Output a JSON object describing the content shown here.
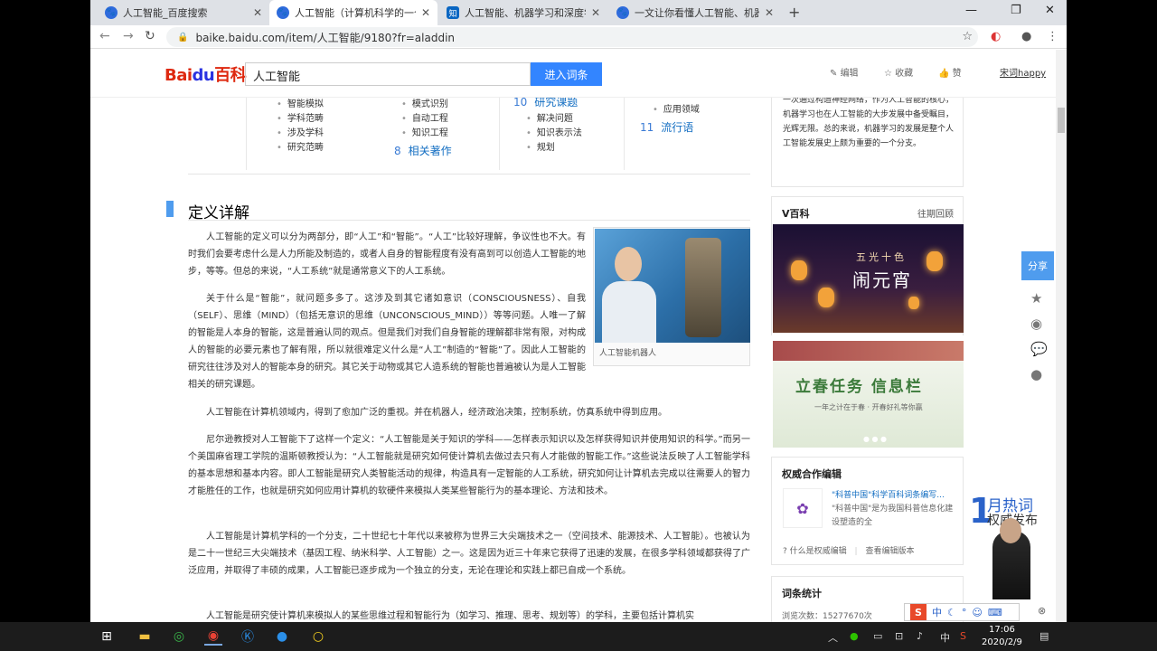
{
  "tabs": [
    {
      "title": "人工智能_百度搜索"
    },
    {
      "title": "人工智能（计算机科学的一个分支）"
    },
    {
      "title": "人工智能、机器学习和深度学习的"
    },
    {
      "title": "一文让你看懂人工智能、机器学"
    }
  ],
  "tab_close": "✕",
  "new_tab": "+",
  "window": {
    "min": "—",
    "max": "❐",
    "close": "✕"
  },
  "address": {
    "url": "baike.baidu.com/item/人工智能/9180?fr=aladdin"
  },
  "header": {
    "logo_a": "Bai",
    "logo_b": "du",
    "logo_c": "百科",
    "search_value": "人工智能",
    "search_button": "进入词条",
    "edit": "编辑",
    "collect": "收藏",
    "like": "赞",
    "user": "宋词happy"
  },
  "toc": {
    "col1": [
      "智能模拟",
      "学科范畴",
      "涉及学科",
      "研究范畴"
    ],
    "col2": [
      "模式识别",
      "自动工程",
      "知识工程"
    ],
    "col3": [
      "解决问题",
      "知识表示法",
      "规划"
    ],
    "col4": [
      "应用领域"
    ],
    "sec10_num": "10",
    "sec10": "研究课题",
    "sec8_num": "8",
    "sec8": "相关著作",
    "sec11_num": "11",
    "sec11": "流行语"
  },
  "section_title": "定义详解",
  "figure_caption": "人工智能机器人",
  "paragraphs": {
    "p1": "人工智能的定义可以分为两部分，即“人工”和“智能”。“人工”比较好理解，争议性也不大。有时我们会要考虑什么是人力所能及制造的，或者人自身的智能程度有没有高到可以创造人工智能的地步，等等。但总的来说，“人工系统”就是通常意义下的人工系统。",
    "p2": "关于什么是“智能”，就问题多多了。这涉及到其它诸如意识（CONSCIOUSNESS）、自我（SELF）、思维（MIND）（包括无意识的思维（UNCONSCIOUS_MIND））等等问题。人唯一了解的智能是人本身的智能，这是普遍认同的观点。但是我们对我们自身智能的理解都非常有限，对构成人的智能的必要元素也了解有限，所以就很难定义什么是“人工”制造的“智能”了。因此人工智能的研究往往涉及对人的智能本身的研究。其它关于动物或其它人造系统的智能也普遍被认为是人工智能相关的研究课题。",
    "p3": "人工智能在计算机领域内，得到了愈加广泛的重视。并在机器人，经济政治决策，控制系统，仿真系统中得到应用。",
    "p4": "尼尔逊教授对人工智能下了这样一个定义：“人工智能是关于知识的学科——怎样表示知识以及怎样获得知识并使用知识的科学。”而另一个美国麻省理工学院的温斯顿教授认为：“人工智能就是研究如何使计算机去做过去只有人才能做的智能工作。”这些说法反映了人工智能学科的基本思想和基本内容。即人工智能是研究人类智能活动的规律，构造具有一定智能的人工系统，研究如何让计算机去完成以往需要人的智力才能胜任的工作，也就是研究如何应用计算机的软硬件来模拟人类某些智能行为的基本理论、方法和技术。",
    "p5": "人工智能是计算机学科的一个分支，二十世纪七十年代以来被称为世界三大尖端技术之一（空间技术、能源技术、人工智能）。也被认为是二十一世纪三大尖端技术（基因工程、纳米科学、人工智能）之一。这是因为近三十年来它获得了迅速的发展，在很多学科领域都获得了广泛应用，并取得了丰硕的成果，人工智能已逐步成为一个独立的分支，无论在理论和实践上都已自成一个系统。",
    "p6": "人工智能是研究使计算机来模拟人的某些思维过程和智能行为（如学习、推理、思考、规划等）的学科，主要包括计算机实"
  },
  "sidebar": {
    "top_text": "一次通过构造神经网络，作为人工智能的核心，机器学习也在人工智能的大步发展中备受瞩目，光辉无限。总的来说，机器学习的发展是整个人工智能发展史上颇为重要的一个分支。",
    "vbaike": "V百科",
    "vbaike_more": "往期回顾",
    "banner1_small": "五光十色",
    "banner1_big": "闹元宵",
    "banner2_big": "立春任务 信息栏",
    "banner2_small": "一年之计在于春 · 开春好礼等你赢",
    "partner_title": "权威合作编辑",
    "partner_name": "\"科普中国\"科学百科词条编写...",
    "partner_desc": "\"科普中国\"是为我国科普信息化建设塑造的全",
    "partner_link1": "什么是权威编辑",
    "partner_link2": "查看编辑版本",
    "stats_title": "词条统计",
    "stats_views": "浏览次数：15277670次",
    "share": "分享",
    "hot_num": "1",
    "hot_t1": "月热词",
    "hot_t2": "权威发布"
  },
  "ime": {
    "label": "中"
  },
  "clock": {
    "time": "17:06",
    "date": "2020/2/9"
  },
  "tray_lang": "中"
}
